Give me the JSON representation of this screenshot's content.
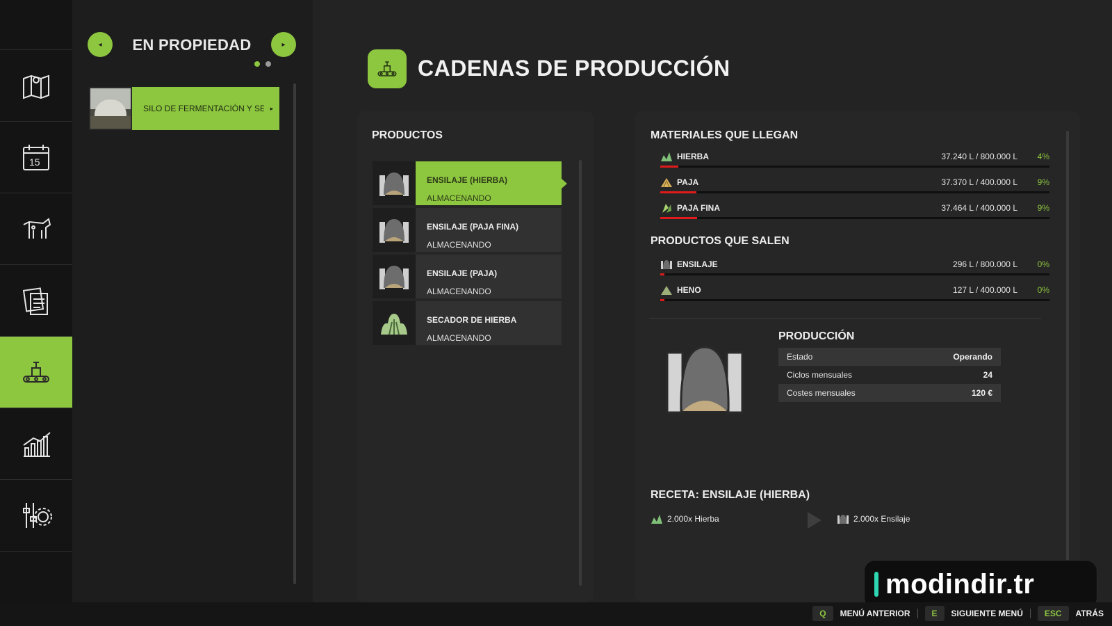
{
  "sidebar": {
    "items": [
      {
        "name": "map",
        "icon": "map-icon"
      },
      {
        "name": "calendar",
        "icon": "calendar-icon",
        "label": "15"
      },
      {
        "name": "animals",
        "icon": "cow-icon"
      },
      {
        "name": "contracts",
        "icon": "documents-icon"
      },
      {
        "name": "production",
        "icon": "production-icon",
        "active": true
      },
      {
        "name": "statistics",
        "icon": "stats-icon"
      },
      {
        "name": "settings",
        "icon": "settings-icon"
      }
    ]
  },
  "owned": {
    "title": "EN PROPIEDAD",
    "prev_icon": "◂",
    "next_icon": "▸",
    "page": 1,
    "pages": 2,
    "item_label": "SILO DE FERMENTACIÓN Y SEC",
    "item_arrow": "▸"
  },
  "header": {
    "title": "CADENAS DE PRODUCCIÓN"
  },
  "products": {
    "heading": "PRODUCTOS",
    "items": [
      {
        "name": "ENSILAJE (HIERBA)",
        "status": "ALMACENANDO",
        "icon": "silage-icon",
        "active": true
      },
      {
        "name": "ENSILAJE (PAJA FINA)",
        "status": "ALMACENANDO",
        "icon": "silage-icon"
      },
      {
        "name": "ENSILAJE (PAJA)",
        "status": "ALMACENANDO",
        "icon": "silage-icon"
      },
      {
        "name": "SECADOR DE HIERBA",
        "status": "ALMACENANDO",
        "icon": "grass-dryer-icon"
      }
    ]
  },
  "incoming": {
    "heading": "MATERIALES QUE LLEGAN",
    "items": [
      {
        "name": "HIERBA",
        "qty": "37.240 L / 800.000 L",
        "pct": "4%",
        "fill": 0.047,
        "icon": "grass-icon"
      },
      {
        "name": "PAJA",
        "qty": "37.370 L / 400.000 L",
        "pct": "9%",
        "fill": 0.093,
        "icon": "straw-icon"
      },
      {
        "name": "PAJA FINA",
        "qty": "37.464 L / 400.000 L",
        "pct": "9%",
        "fill": 0.094,
        "icon": "chaff-icon"
      }
    ]
  },
  "outgoing": {
    "heading": "PRODUCTOS QUE SALEN",
    "items": [
      {
        "name": "ENSILAJE",
        "qty": "296 L / 800.000 L",
        "pct": "0%",
        "fill": 0.01,
        "icon": "silage-small-icon"
      },
      {
        "name": "HENO",
        "qty": "127 L / 400.000 L",
        "pct": "0%",
        "fill": 0.01,
        "icon": "hay-icon"
      }
    ]
  },
  "production": {
    "heading": "PRODUCCIÓN",
    "rows": [
      {
        "label": "Estado",
        "value": "Operando"
      },
      {
        "label": "Ciclos mensuales",
        "value": "24"
      },
      {
        "label": "Costes mensuales",
        "value": "120 €"
      }
    ]
  },
  "recipe": {
    "heading": "RECETA: ENSILAJE (HIERBA)",
    "input": "2.000x Hierba",
    "output": "2.000x Ensilaje"
  },
  "watermark": {
    "text": "modindir.tr"
  },
  "footer": {
    "hints": [
      {
        "key": "Q",
        "label": "MENÚ ANTERIOR"
      },
      {
        "key": "E",
        "label": "SIGUIENTE MENÚ"
      },
      {
        "key": "ESC",
        "label": "ATRÁS"
      }
    ]
  },
  "colors": {
    "accent": "#8dc63f",
    "bar_fill": "#e01b1b",
    "background": "#232323"
  }
}
